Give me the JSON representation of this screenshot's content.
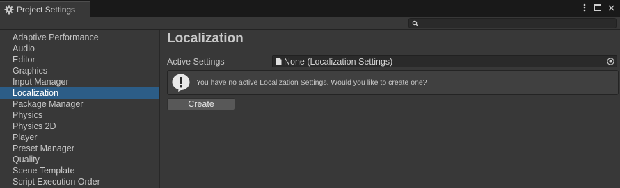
{
  "window": {
    "tab_title": "Project Settings",
    "tab_icon": "gear-icon",
    "controls": [
      "more-options-icon",
      "maximize-icon",
      "close-icon"
    ]
  },
  "search": {
    "placeholder": "",
    "icon": "search-icon"
  },
  "sidebar": {
    "items": [
      {
        "label": "Adaptive Performance",
        "selected": false
      },
      {
        "label": "Audio",
        "selected": false
      },
      {
        "label": "Editor",
        "selected": false
      },
      {
        "label": "Graphics",
        "selected": false
      },
      {
        "label": "Input Manager",
        "selected": false
      },
      {
        "label": "Localization",
        "selected": true
      },
      {
        "label": "Package Manager",
        "selected": false
      },
      {
        "label": "Physics",
        "selected": false
      },
      {
        "label": "Physics 2D",
        "selected": false
      },
      {
        "label": "Player",
        "selected": false
      },
      {
        "label": "Preset Manager",
        "selected": false
      },
      {
        "label": "Quality",
        "selected": false
      },
      {
        "label": "Scene Template",
        "selected": false
      },
      {
        "label": "Script Execution Order",
        "selected": false
      }
    ]
  },
  "main": {
    "title": "Localization",
    "active_settings_label": "Active Settings",
    "active_settings_value": "None (Localization Settings)",
    "help_message": "You have no active Localization Settings. Would you like to create one?",
    "create_label": "Create"
  },
  "colors": {
    "selection": "#2c5d87",
    "panel": "#383838",
    "titlebar": "#191919"
  }
}
